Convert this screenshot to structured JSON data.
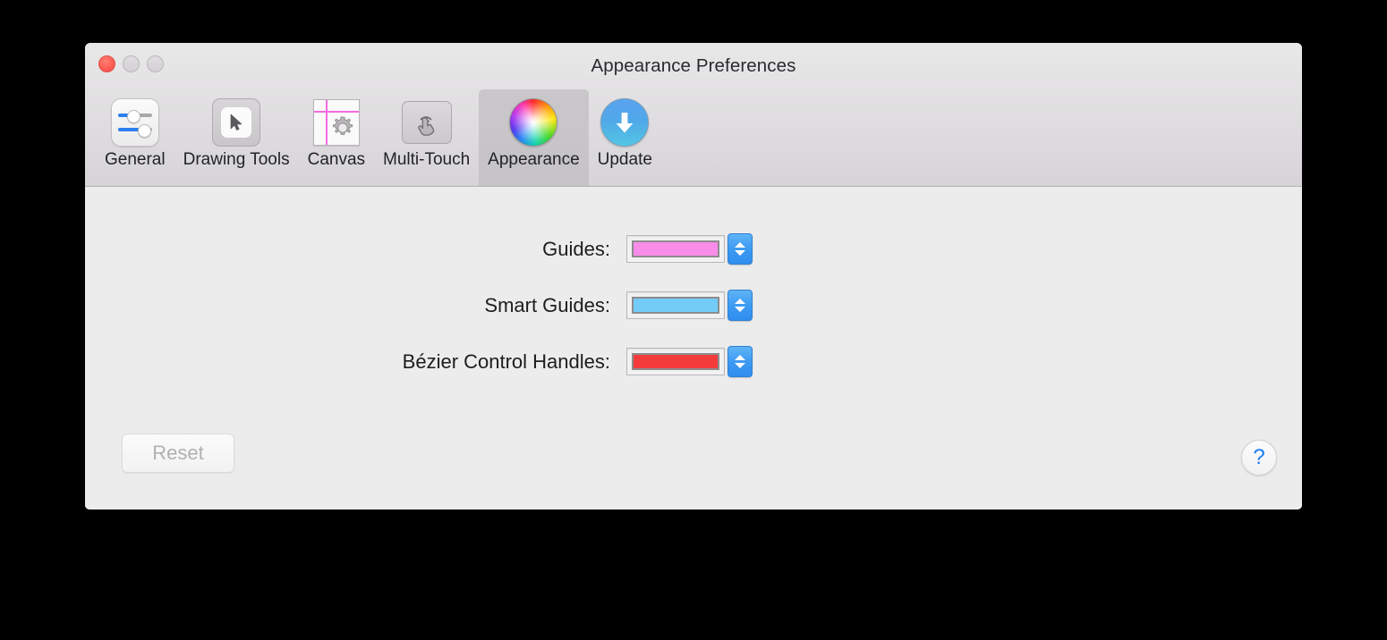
{
  "window": {
    "title": "Appearance Preferences",
    "traffic_lights": [
      {
        "name": "close",
        "color": "#fc5d55"
      },
      {
        "name": "minimize",
        "color": "#d6d4d6"
      },
      {
        "name": "zoom",
        "color": "#d6d4d6"
      }
    ]
  },
  "toolbar": {
    "selected": "Appearance",
    "tabs": [
      {
        "label": "General",
        "icon": "sliders-icon"
      },
      {
        "label": "Drawing Tools",
        "icon": "cursor-icon"
      },
      {
        "label": "Canvas",
        "icon": "canvas-gear-icon"
      },
      {
        "label": "Multi-Touch",
        "icon": "hand-tap-icon"
      },
      {
        "label": "Appearance",
        "icon": "color-wheel-icon"
      },
      {
        "label": "Update",
        "icon": "download-arrow-icon"
      }
    ]
  },
  "settings": {
    "rows": [
      {
        "label": "Guides:",
        "color": "#f98ce8",
        "swatch_border": "#8d8b8d"
      },
      {
        "label": "Smart Guides:",
        "color": "#72ccf7",
        "swatch_border": "#8d8b8d"
      },
      {
        "label": "Bézier Control Handles:",
        "color": "#f43c3c",
        "swatch_border": "#8d8b8d"
      }
    ]
  },
  "footer": {
    "reset_label": "Reset",
    "reset_enabled": "false",
    "help_label": "?"
  }
}
